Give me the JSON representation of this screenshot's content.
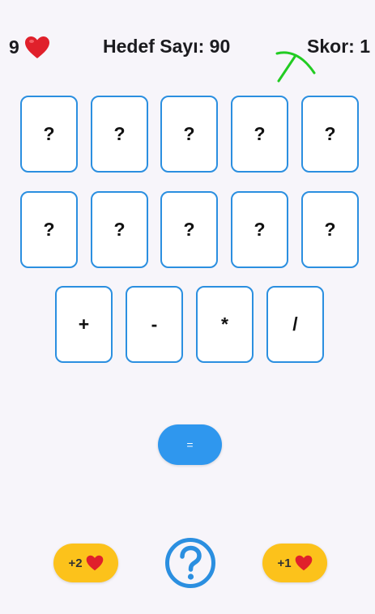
{
  "header": {
    "lives": "9",
    "lives_icon": "heart-icon",
    "target_label": "Hedef Sayı: 90",
    "score_label": "Skor: 1"
  },
  "number_cards": [
    "?",
    "?",
    "?",
    "?",
    "?",
    "?",
    "?",
    "?",
    "?",
    "?"
  ],
  "operator_cards": [
    "+",
    "-",
    "*",
    "/"
  ],
  "equals_button": "=",
  "bonus_left": {
    "label": "+2",
    "icon": "heart-icon"
  },
  "bonus_right": {
    "label": "+1",
    "icon": "heart-icon"
  },
  "help_icon": "question-circle-icon",
  "colors": {
    "accent_blue": "#2b8fe0",
    "bonus_yellow": "#fcc21b",
    "heart_red": "#e0202b",
    "cursor_green": "#22cc22"
  }
}
